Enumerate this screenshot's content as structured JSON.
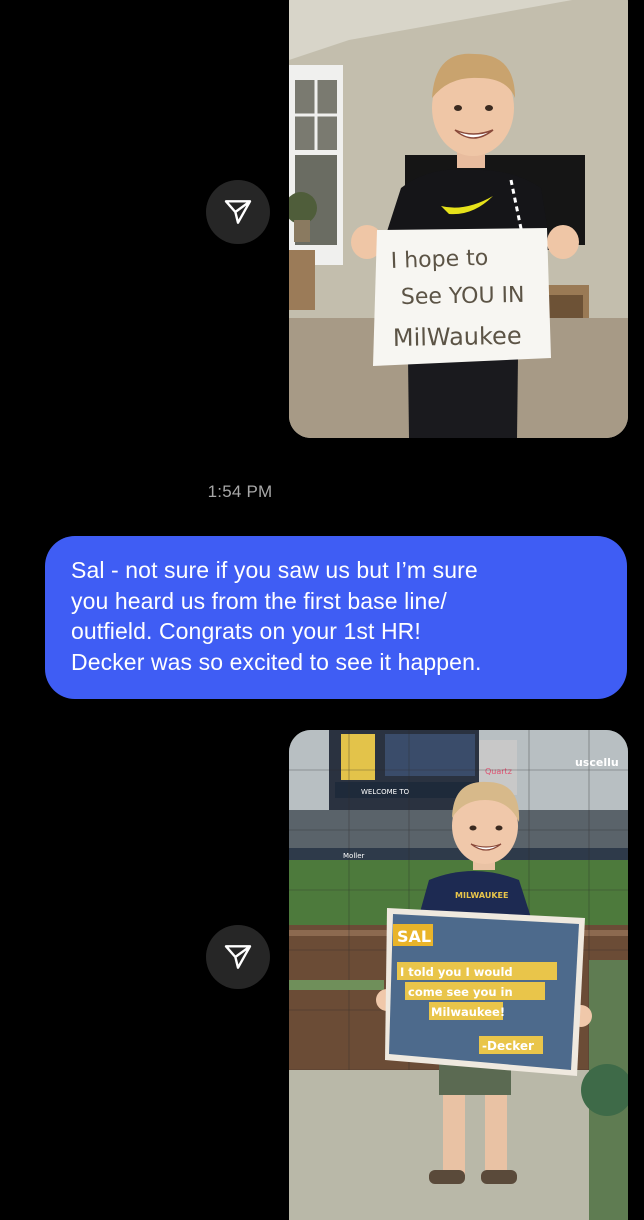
{
  "thread": {
    "timestamp": "1:54 PM",
    "outgoing_message": {
      "lines": [
        "Sal - not sure if you saw us but I’m sure",
        "you heard us from the first base line/",
        "outfield. Congrats on your 1st HR!",
        "Decker was so excited to see it happen."
      ],
      "bubble_color": "#3f5df4"
    },
    "photo1": {
      "sign_lines": [
        "I hope to",
        "See YOU IN",
        "MilWaukee"
      ]
    },
    "photo2": {
      "shirt_text": "MILWAUKEE",
      "sign_lines": [
        "SAL",
        "I told you I would",
        "come see you in",
        "Milwaukee!",
        "-Decker"
      ],
      "stadium_text": [
        "uscellu",
        "WELCOME TO",
        "Quartz",
        "Moller"
      ]
    },
    "share_icon": "send-paper-plane-icon"
  }
}
